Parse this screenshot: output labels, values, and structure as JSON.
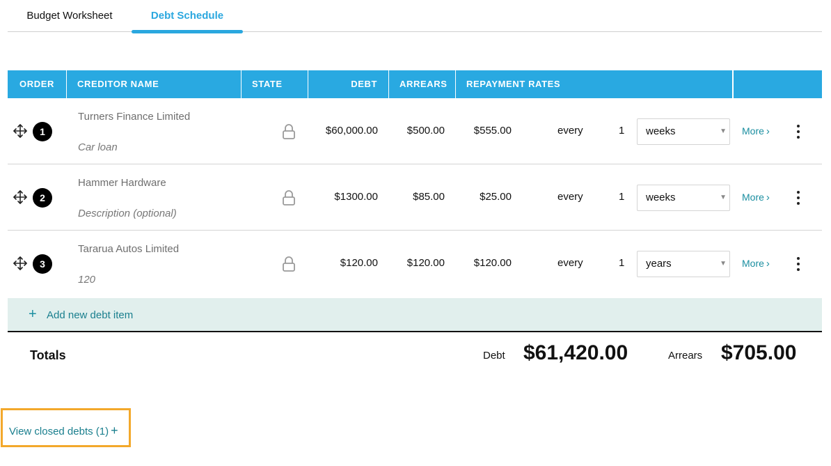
{
  "tabs": [
    {
      "label": "Budget Worksheet",
      "active": false
    },
    {
      "label": "Debt Schedule",
      "active": true
    }
  ],
  "table": {
    "headers": {
      "order": "ORDER",
      "creditor": "CREDITOR NAME",
      "state": "STATE",
      "debt": "DEBT",
      "arrears": "ARREARS",
      "rates": "REPAYMENT RATES"
    },
    "rows": [
      {
        "order": "1",
        "creditor": "Turners Finance Limited",
        "description": "Car loan",
        "state_icon": "lock-icon",
        "debt": "$60,000.00",
        "arrears": "$500.00",
        "rate": "$555.00",
        "every": "every",
        "count": "1",
        "period": "weeks",
        "more": "More"
      },
      {
        "order": "2",
        "creditor": "Hammer Hardware",
        "description": "Description (optional)",
        "state_icon": "lock-icon",
        "debt": "$1300.00",
        "arrears": "$85.00",
        "rate": "$25.00",
        "every": "every",
        "count": "1",
        "period": "weeks",
        "more": "More"
      },
      {
        "order": "3",
        "creditor": "Tararua Autos Limited",
        "description": "120",
        "state_icon": "lock-icon",
        "debt": "$120.00",
        "arrears": "$120.00",
        "rate": "$120.00",
        "every": "every",
        "count": "1",
        "period": "years",
        "more": "More"
      }
    ],
    "add_label": "Add new debt item"
  },
  "totals": {
    "label": "Totals",
    "debt_label": "Debt",
    "debt_value": "$61,420.00",
    "arrears_label": "Arrears",
    "arrears_value": "$705.00"
  },
  "closed": {
    "label": "View closed debts (1)"
  },
  "colors": {
    "header_bg": "#29a9e1",
    "accent_teal": "#1a8ea0",
    "add_row_bg": "#e1efed",
    "highlight_border": "#f3a82b"
  }
}
